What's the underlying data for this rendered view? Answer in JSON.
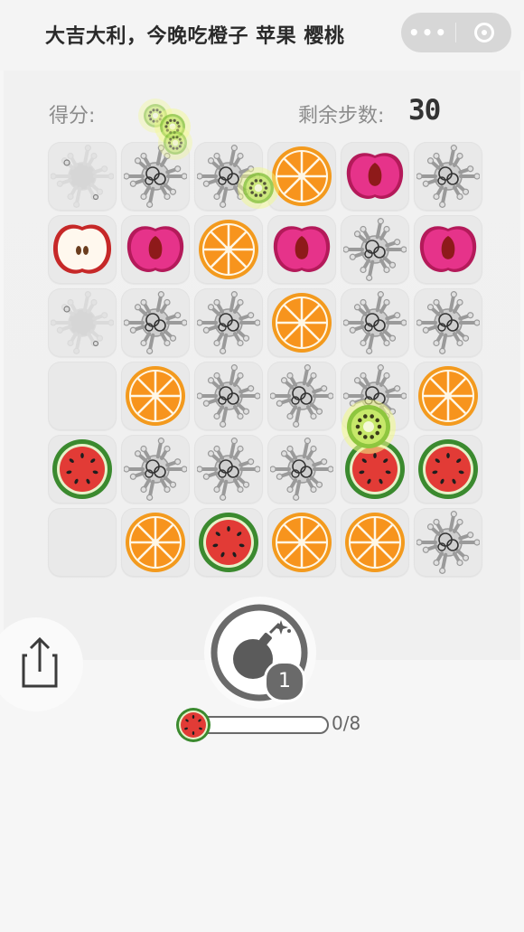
{
  "header": {
    "title": "大吉大利，今晚吃橙子 苹果 樱桃",
    "more_label": "•••",
    "capsule_more_icon": "more-dots-icon",
    "capsule_close_icon": "target-close-icon"
  },
  "hud": {
    "score_label": "得分:",
    "steps_label": "剩余步数:",
    "steps_value": "30"
  },
  "board": {
    "rows": 6,
    "cols": 6,
    "tiles": [
      [
        "splash-faint",
        "splash",
        "splash",
        "orange",
        "cherry",
        "splash"
      ],
      [
        "apple",
        "cherry",
        "orange",
        "cherry",
        "splash",
        "cherry"
      ],
      [
        "splash-faint",
        "splash",
        "splash",
        "orange",
        "splash",
        "splash"
      ],
      [
        "empty",
        "orange",
        "splash",
        "splash",
        "splash",
        "orange"
      ],
      [
        "watermelon",
        "splash",
        "splash",
        "splash",
        "watermelon",
        "watermelon"
      ],
      [
        "empty",
        "orange",
        "watermelon",
        "orange",
        "orange",
        "splash"
      ]
    ]
  },
  "effects": [
    "kiwi-sparkle-icon",
    "kiwi-sparkle-icon",
    "kiwi-sparkle-icon"
  ],
  "tools": {
    "share_icon": "share-icon",
    "bomb_icon": "bomb-icon",
    "bomb_count": "1"
  },
  "progress": {
    "target_icon": "watermelon-icon",
    "text": "0/8",
    "current": 0,
    "total": 8
  },
  "colors": {
    "orange": "#f7941d",
    "cherry": "#e6338a",
    "watermelon_flesh": "#e23b36",
    "watermelon_rind": "#3b8a2f",
    "kiwi": "#a8d83a",
    "tile": "#e9e9e9"
  }
}
